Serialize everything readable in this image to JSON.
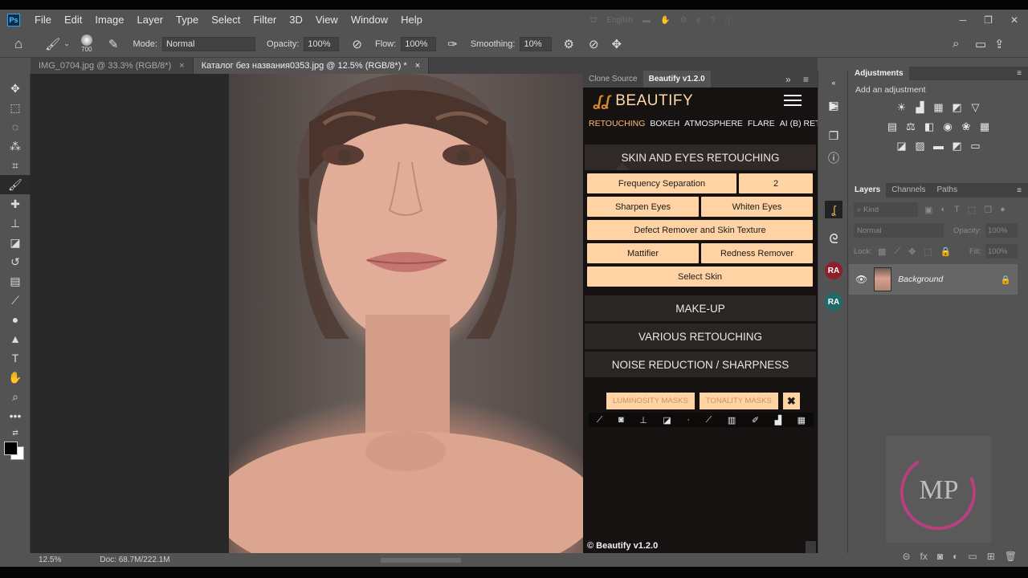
{
  "menubar": {
    "app_icon": "Ps",
    "items": [
      "File",
      "Edit",
      "Image",
      "Layer",
      "Type",
      "Select",
      "Filter",
      "3D",
      "View",
      "Window",
      "Help"
    ],
    "language": "English"
  },
  "options_bar": {
    "brush_size": "700",
    "mode_label": "Mode:",
    "mode_value": "Normal",
    "opacity_label": "Opacity:",
    "opacity_value": "100%",
    "flow_label": "Flow:",
    "flow_value": "100%",
    "smoothing_label": "Smoothing:",
    "smoothing_value": "10%"
  },
  "document_tabs": [
    {
      "label": "IMG_0704.jpg @ 33.3% (RGB/8*)",
      "close": "×"
    },
    {
      "label": "Каталог без названия0353.jpg @ 12.5% (RGB/8*) *",
      "close": "×"
    }
  ],
  "status_bar": {
    "zoom": "12.5%",
    "doc_info": "Doc: 68.7M/222.1M"
  },
  "beautify": {
    "tabs": [
      "Clone Source",
      "Beautify v1.2.0"
    ],
    "tab_expand": "»",
    "logo_text": "BEAUTIFY",
    "nav": [
      "RETOUCHING",
      "BOKEH",
      "ATMOSPHERE",
      "FLARE",
      "AI (B) RETOUCH"
    ],
    "skin_section": "SKIN AND EYES RETOUCHING",
    "buttons": {
      "frequency_separation": "Frequency Separation",
      "frequency_value": "2",
      "sharpen_eyes": "Sharpen Eyes",
      "whiten_eyes": "Whiten Eyes",
      "defect_remover": "Defect Remover and Skin Texture",
      "mattifier": "Mattifier",
      "redness_remover": "Redness Remover",
      "select_skin": "Select Skin"
    },
    "sections": [
      "MAKE-UP",
      "VARIOUS RETOUCHING",
      "NOISE REDUCTION / SHARPNESS"
    ],
    "masks": {
      "luminosity": "LUMINOSITY MASKS",
      "tonality": "TONALITY MASKS",
      "close": "✖"
    },
    "footer": "© Beautify v1.2.0"
  },
  "side_strip": {
    "ra_label": "RA"
  },
  "adjustments": {
    "title": "Adjustments",
    "subtitle": "Add an adjustment"
  },
  "layers": {
    "tabs": [
      "Layers",
      "Channels",
      "Paths"
    ],
    "kind_placeholder": "Kind",
    "blend_mode": "Normal",
    "opacity_label": "Opacity:",
    "opacity_value": "100%",
    "lock_label": "Lock:",
    "fill_label": "Fill:",
    "fill_value": "100%",
    "layer_name": "Background"
  },
  "watermark": {
    "text": "MP"
  },
  "colors": {
    "accent_peach": "#ffd3a3",
    "nav_active": "#ffb977",
    "ra_red": "#8f1f2b",
    "ra_teal": "#1d6b6b"
  }
}
